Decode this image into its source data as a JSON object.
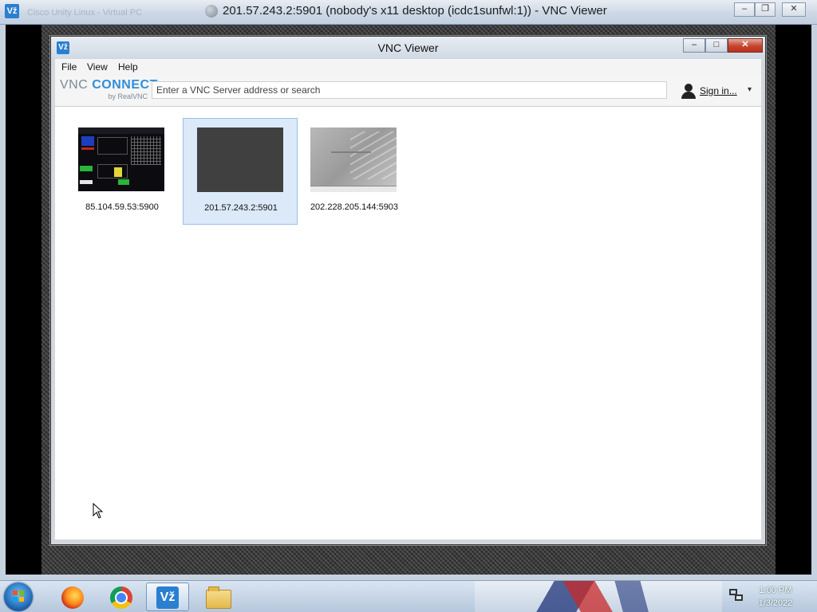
{
  "outer_window": {
    "title": "201.57.243.2:5901 (nobody's x11 desktop (icdc1sunfwl:1)) - VNC Viewer",
    "logo": "Vž",
    "ghost_tab": "Cisco Unity Linux - Virtual PC",
    "controls": {
      "minimize": "‒",
      "maximize": "❐",
      "close": "✕"
    }
  },
  "vnc_viewer": {
    "title": "VNC Viewer",
    "logo": "Vž",
    "controls": {
      "minimize": "‒",
      "maximize": "□",
      "close": "✕"
    },
    "menu": [
      "File",
      "View",
      "Help"
    ],
    "brand": {
      "main_vnc": "VNC",
      "main_connect": "CONNECT",
      "sub": "by RealVNC"
    },
    "search": {
      "placeholder": "Enter a VNC Server address or search",
      "value": ""
    },
    "sign_in": {
      "label": "Sign in...",
      "icon": "user-icon",
      "caret": "▾"
    },
    "connections": [
      {
        "address": "85.104.59.53:5900",
        "selected": false
      },
      {
        "address": "201.57.243.2:5901",
        "selected": true
      },
      {
        "address": "202.228.205.144:5903",
        "selected": false
      }
    ]
  },
  "taskbar": {
    "buttons": [
      "start-orb",
      "firefox-icon",
      "chrome-icon",
      "vnc-viewer-icon",
      "file-explorer-icon"
    ],
    "vnc_logo": "Vž",
    "clock": {
      "time": "1:00 PM",
      "date": "1/3/2022"
    }
  }
}
